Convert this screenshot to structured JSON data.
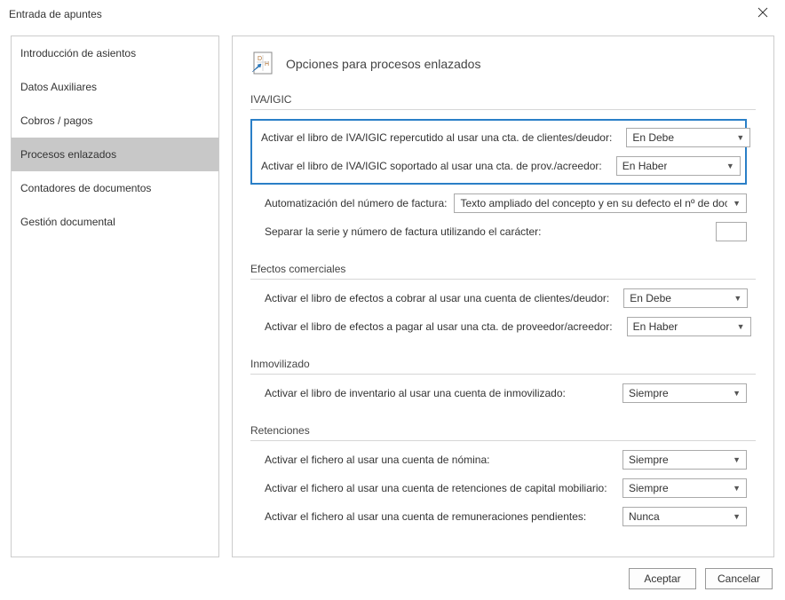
{
  "window": {
    "title": "Entrada de apuntes"
  },
  "sidebar": {
    "items": [
      {
        "label": "Introducción de asientos"
      },
      {
        "label": "Datos Auxiliares"
      },
      {
        "label": "Cobros / pagos"
      },
      {
        "label": "Procesos enlazados"
      },
      {
        "label": "Contadores de documentos"
      },
      {
        "label": "Gestión documental"
      }
    ]
  },
  "main": {
    "title": "Opciones para procesos enlazados",
    "sections": {
      "iva": {
        "heading": "IVA/IGIC",
        "row1": {
          "label": "Activar el libro de IVA/IGIC repercutido al usar una cta. de clientes/deudor:",
          "value": "En Debe"
        },
        "row2": {
          "label": "Activar el libro de IVA/IGIC soportado al usar una cta. de prov./acreedor:",
          "value": "En Haber"
        },
        "row3": {
          "label": "Automatización del número de factura:",
          "value": "Texto ampliado del concepto y en su defecto el nº de docu"
        },
        "row4": {
          "label": "Separar la serie y número de factura utilizando el carácter:",
          "value": ""
        }
      },
      "efectos": {
        "heading": "Efectos comerciales",
        "row1": {
          "label": "Activar el libro de efectos a cobrar al usar una cuenta de clientes/deudor:",
          "value": "En Debe"
        },
        "row2": {
          "label": "Activar el libro de efectos a pagar al usar una cta. de proveedor/acreedor:",
          "value": "En Haber"
        }
      },
      "inmov": {
        "heading": "Inmovilizado",
        "row1": {
          "label": "Activar el libro de inventario al usar una cuenta de inmovilizado:",
          "value": "Siempre"
        }
      },
      "ret": {
        "heading": "Retenciones",
        "row1": {
          "label": "Activar el fichero al usar una cuenta de nómina:",
          "value": "Siempre"
        },
        "row2": {
          "label": "Activar el fichero al usar una cuenta de retenciones de capital mobiliario:",
          "value": "Siempre"
        },
        "row3": {
          "label": "Activar el fichero al usar una cuenta de remuneraciones pendientes:",
          "value": "Nunca"
        }
      }
    }
  },
  "footer": {
    "accept": "Aceptar",
    "cancel": "Cancelar"
  }
}
